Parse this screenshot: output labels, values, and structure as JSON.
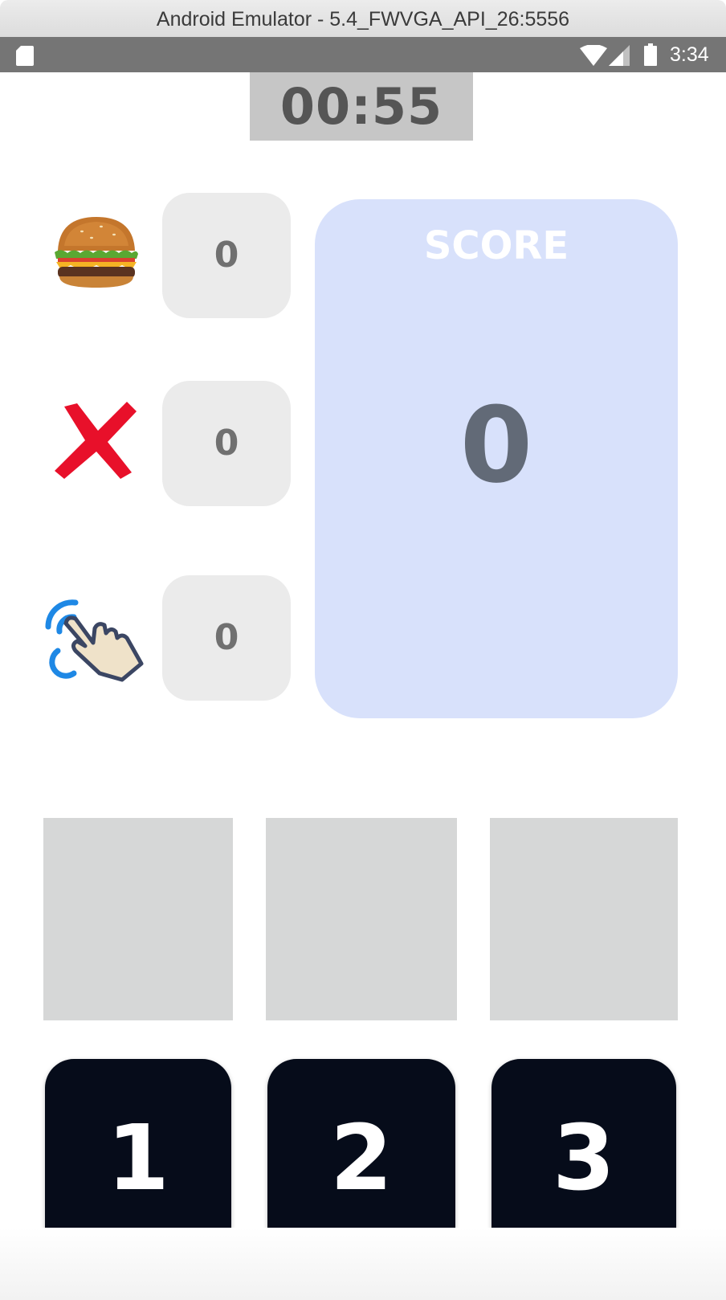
{
  "window": {
    "title": "Android Emulator - 5.4_FWVGA_API_26:5556"
  },
  "status_bar": {
    "time": "3:34",
    "icons": [
      "sd-card-icon",
      "wifi-icon",
      "cell-signal-icon",
      "battery-icon"
    ]
  },
  "game": {
    "timer": "00:55",
    "stats": [
      {
        "icon": "burger-icon",
        "value": "0"
      },
      {
        "icon": "x-mark-icon",
        "value": "0"
      },
      {
        "icon": "tap-hand-icon",
        "value": "0"
      }
    ],
    "score": {
      "label": "SCORE",
      "value": "0"
    },
    "buttons": [
      {
        "label": "1"
      },
      {
        "label": "2"
      },
      {
        "label": "3"
      }
    ]
  },
  "colors": {
    "score_panel": "#d8e1fb",
    "counter_bg": "#ebebeb",
    "slot_bg": "#d6d7d7",
    "button_bg": "#060c1a",
    "timer_bg": "#c6c6c6",
    "status_bar": "#757575",
    "x_mark": "#e8102a",
    "tap_ripple": "#1e88e5"
  }
}
